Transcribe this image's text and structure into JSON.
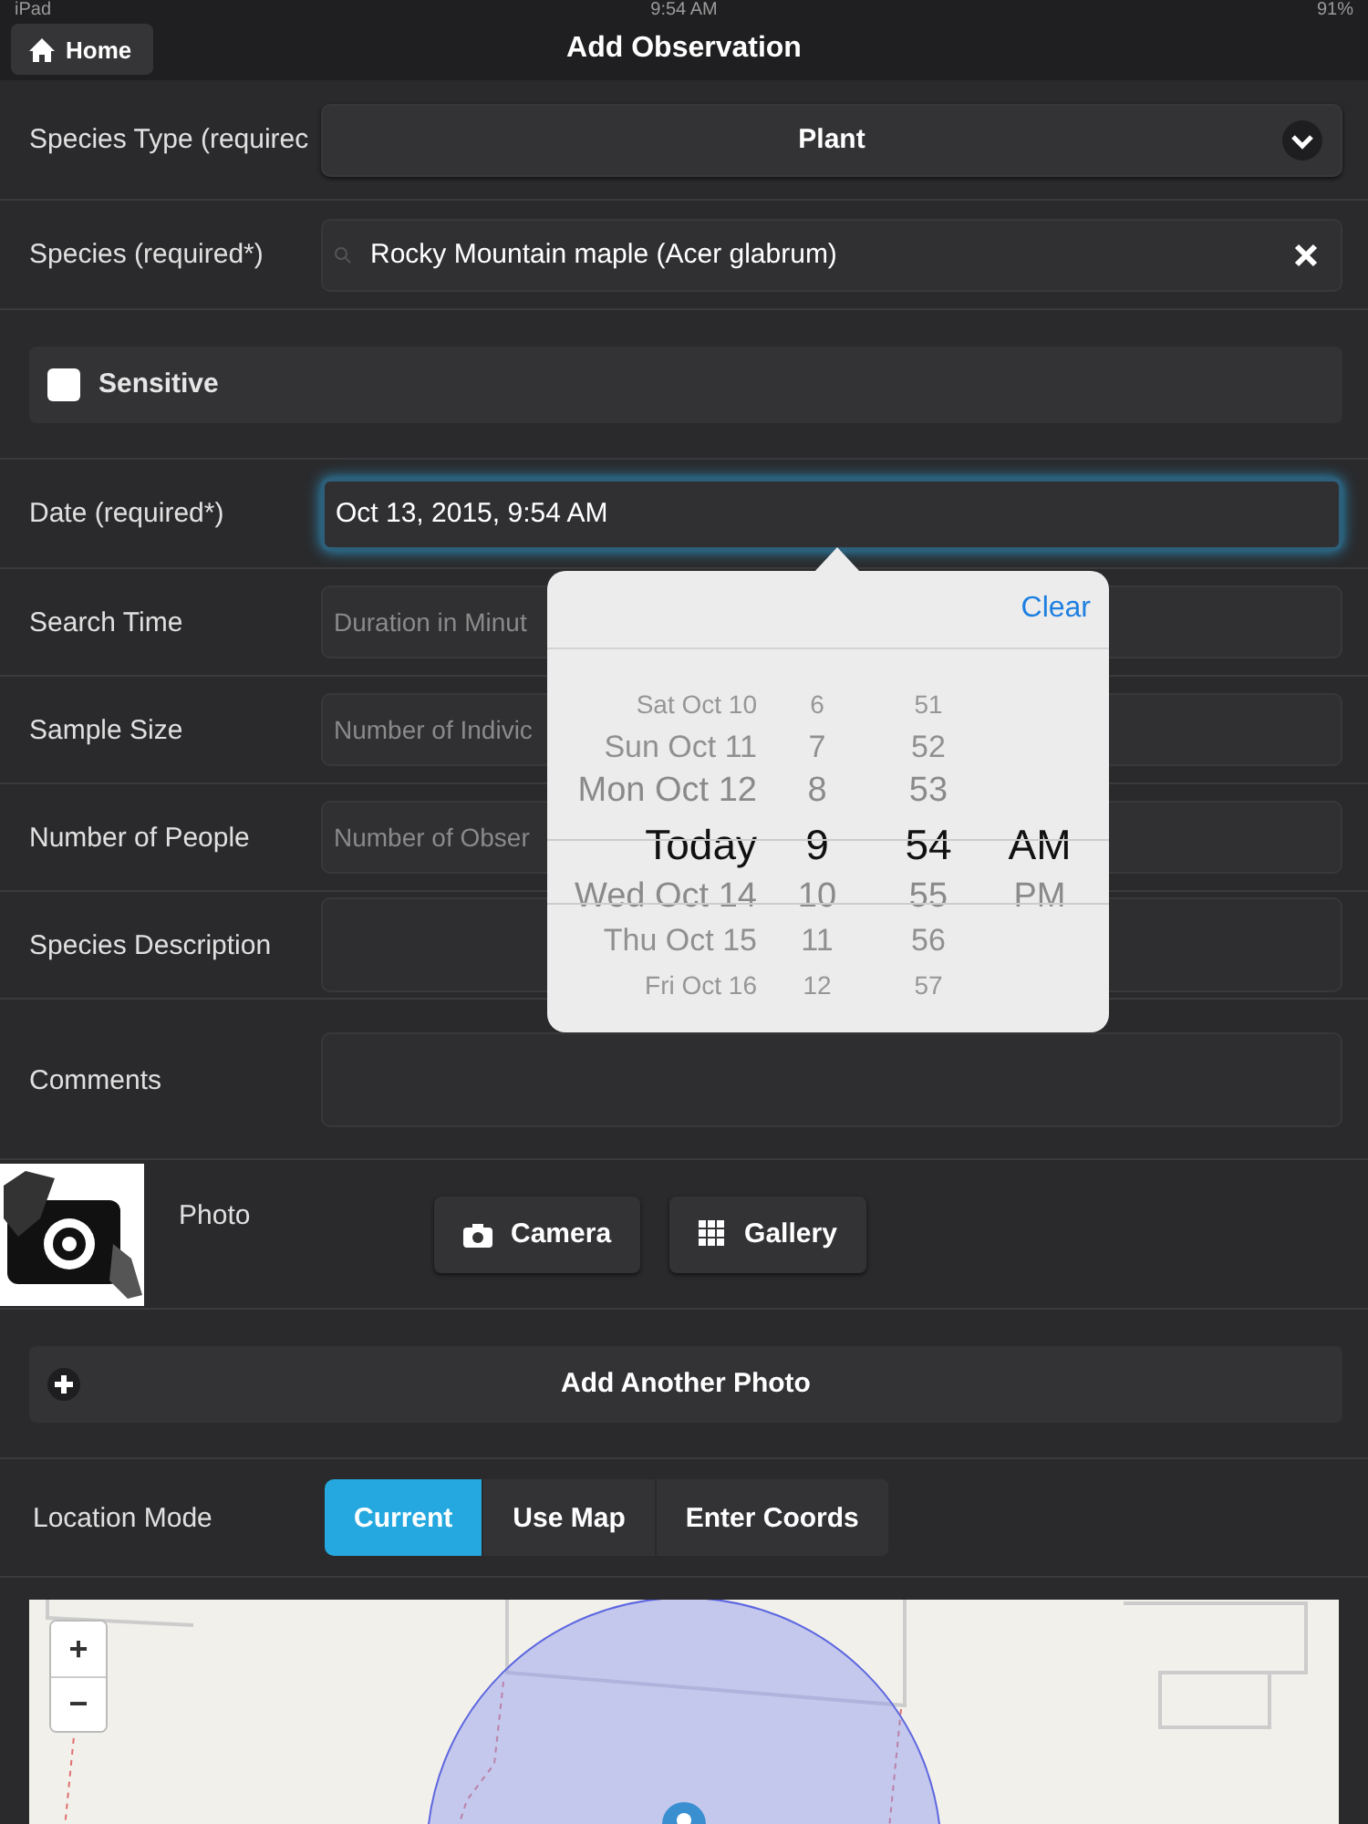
{
  "status_bar": {
    "device": "iPad",
    "time": "9:54 AM",
    "battery": "91%"
  },
  "nav": {
    "home_button": "Home",
    "title": "Add Observation"
  },
  "form": [
    {
      "kind": "select",
      "label": "Species Type (requirec",
      "value": "Plant"
    },
    {
      "kind": "search",
      "label": "Species (required*)",
      "value": "Rocky Mountain maple (Acer glabrum)"
    },
    {
      "kind": "checkbox",
      "label": "Sensitive",
      "checked": false
    },
    {
      "kind": "text",
      "label": "Date (required*)",
      "value": "Oct 13, 2015, 9:54 AM",
      "focused": true
    },
    {
      "kind": "text",
      "label": "Search Time",
      "placeholder": "Duration in Minut",
      "focused": false
    },
    {
      "kind": "text",
      "label": "Sample Size",
      "placeholder": "Number of Indivic",
      "focused": false
    },
    {
      "kind": "text",
      "label": "Number of People",
      "placeholder": "Number of Obser",
      "focused": false
    },
    {
      "kind": "textarea",
      "label": "Species Description"
    },
    {
      "kind": "textarea",
      "label": "Comments"
    },
    {
      "kind": "photo",
      "label": "Photo",
      "buttons": [
        "Camera",
        "Gallery"
      ]
    },
    {
      "kind": "add",
      "label": "Add Another Photo"
    },
    {
      "kind": "segmented",
      "label": "Location Mode",
      "options": [
        {
          "label": "Current",
          "selected": true
        },
        {
          "label": "Use Map",
          "selected": false
        },
        {
          "label": "Enter Coords",
          "selected": false
        }
      ]
    }
  ],
  "map": {
    "zoom_in": "+",
    "zoom_out": "−"
  },
  "picker": {
    "clear": "Clear",
    "columns": [
      {
        "kind": "day",
        "items": [
          {
            "label": "Sat Oct 10",
            "selected": false
          },
          {
            "label": "Sun Oct 11",
            "selected": false
          },
          {
            "label": "Mon Oct 12",
            "selected": false
          },
          {
            "label": "Today",
            "selected": true
          },
          {
            "label": "Wed Oct 14",
            "selected": false
          },
          {
            "label": "Thu Oct 15",
            "selected": false
          },
          {
            "label": "Fri Oct 16",
            "selected": false
          }
        ]
      },
      {
        "kind": "hour",
        "items": [
          {
            "label": "6",
            "selected": false
          },
          {
            "label": "7",
            "selected": false
          },
          {
            "label": "8",
            "selected": false
          },
          {
            "label": "9",
            "selected": true
          },
          {
            "label": "10",
            "selected": false
          },
          {
            "label": "11",
            "selected": false
          },
          {
            "label": "12",
            "selected": false
          }
        ]
      },
      {
        "kind": "minute",
        "items": [
          {
            "label": "51",
            "selected": false
          },
          {
            "label": "52",
            "selected": false
          },
          {
            "label": "53",
            "selected": false
          },
          {
            "label": "54",
            "selected": true
          },
          {
            "label": "55",
            "selected": false
          },
          {
            "label": "56",
            "selected": false
          },
          {
            "label": "57",
            "selected": false
          }
        ]
      },
      {
        "kind": "period",
        "items": [
          {
            "label": "AM",
            "selected": true
          },
          {
            "label": "PM",
            "selected": false
          }
        ]
      }
    ]
  }
}
